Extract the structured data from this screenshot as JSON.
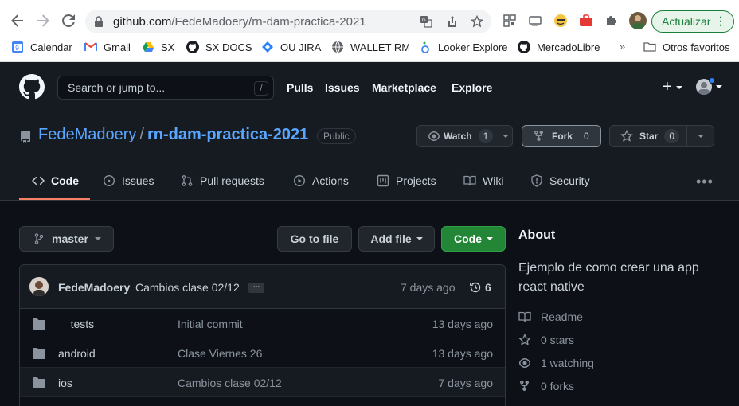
{
  "browser": {
    "url_host": "github.com",
    "url_path": "/FedeMadoery/rn-dam-practica-2021",
    "update_label": "Actualizar",
    "bookmarks": [
      {
        "label": "Calendar",
        "icon": "google-calendar-icon"
      },
      {
        "label": "Gmail",
        "icon": "gmail-icon"
      },
      {
        "label": "SX",
        "icon": "google-drive-icon"
      },
      {
        "label": "SX DOCS",
        "icon": "github-icon"
      },
      {
        "label": "OU JIRA",
        "icon": "jira-icon"
      },
      {
        "label": "WALLET RM",
        "icon": "globe-icon"
      },
      {
        "label": "Looker Explore",
        "icon": "looker-icon"
      },
      {
        "label": "MercadoLibre",
        "icon": "github-icon"
      },
      {
        "label": "Otros favoritos",
        "icon": "folder-icon"
      }
    ],
    "overflow_label": "»"
  },
  "gh_header": {
    "search_placeholder": "Search or jump to...",
    "search_shortcut": "/",
    "nav": [
      "Pulls",
      "Issues",
      "Marketplace",
      "Explore"
    ],
    "plus_label": "+"
  },
  "repo": {
    "owner": "FedeMadoery",
    "separator": "/",
    "name": "rn-dam-practica-2021",
    "visibility": "Public",
    "watch_label": "Watch",
    "watch_count": "1",
    "fork_label": "Fork",
    "fork_count": "0",
    "star_label": "Star",
    "star_count": "0"
  },
  "tabs": [
    {
      "label": "Code",
      "icon": "code-icon",
      "active": true
    },
    {
      "label": "Issues",
      "icon": "issue-icon"
    },
    {
      "label": "Pull requests",
      "icon": "pull-request-icon"
    },
    {
      "label": "Actions",
      "icon": "play-icon"
    },
    {
      "label": "Projects",
      "icon": "project-icon"
    },
    {
      "label": "Wiki",
      "icon": "book-icon"
    },
    {
      "label": "Security",
      "icon": "shield-icon"
    }
  ],
  "toolbar": {
    "branch": "master",
    "go_to_file": "Go to file",
    "add_file": "Add file",
    "code": "Code"
  },
  "latest_commit": {
    "author": "FedeMadoery",
    "message": "Cambios clase 02/12",
    "ellipsis": "...",
    "time": "7 days ago",
    "commit_count": "6"
  },
  "files": [
    {
      "name": "__tests__",
      "message": "Initial commit",
      "time": "13 days ago"
    },
    {
      "name": "android",
      "message": "Clase Viernes 26",
      "time": "13 days ago"
    },
    {
      "name": "ios",
      "message": "Cambios clase 02/12",
      "time": "7 days ago"
    }
  ],
  "about": {
    "title": "About",
    "description": "Ejemplo de como crear una app react native",
    "readme": "Readme",
    "stars": "0 stars",
    "watching": "1 watching",
    "forks": "0 forks"
  },
  "colors": {
    "accent_blue": "#58a6ff",
    "green_button": "#238636",
    "tab_underline": "#f78166",
    "bg": "#0d1117",
    "header_bg": "#161b22"
  }
}
